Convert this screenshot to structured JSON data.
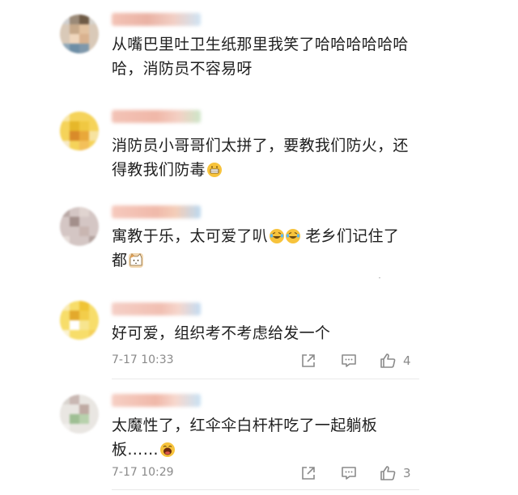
{
  "comments": [
    {
      "text_line1": "从嘴巴里吐卫生纸那里我笑了哈哈哈哈哈哈",
      "text_line2": "哈，消防员不容易呀"
    },
    {
      "text_line1": "消防员小哥哥们太拼了，要教我们防火，还",
      "text_line2": "得教我们防毒"
    },
    {
      "text_line1a": "寓教于乐，太可爱了叭",
      "text_line1b": "老乡们记住了",
      "text_line2": "都"
    },
    {
      "text_line1": "好可爱，组织考不考虑给发一个",
      "time": "7-17 10:33",
      "likes": "4"
    },
    {
      "text_line1": "太魔性了，红伞伞白杆杆吃了一起躺板",
      "text_line2": "板……",
      "time": "7-17 10:29",
      "likes": "3"
    }
  ],
  "icons": [
    "share-icon",
    "comment-icon",
    "like-icon"
  ],
  "colors": {
    "text": "#1f1f1f",
    "meta": "#8a8a8a",
    "emoji": "#f7c33c"
  }
}
